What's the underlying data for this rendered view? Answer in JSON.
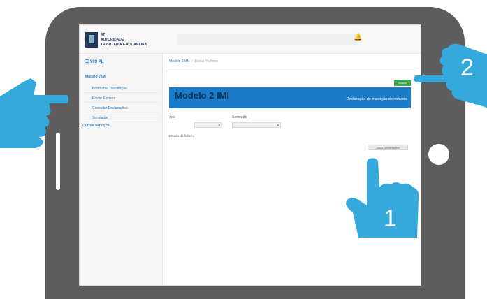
{
  "topbar": {
    "logo_lines": [
      "AT",
      "AUTORIDADE",
      "TRIBUTÁRIA E ADUANEIRA"
    ],
    "bell_icon": "bell-icon"
  },
  "sidebar": {
    "user": "☰ 999 PL",
    "group": "Modelo 2 IMI",
    "items": [
      {
        "label": "Preencher Declaração"
      },
      {
        "label": "Enviar Ficheiro"
      },
      {
        "label": "Consultar Declarações"
      },
      {
        "label": "Simulador"
      }
    ],
    "other": "Outros Serviços"
  },
  "main": {
    "breadcrumb": [
      "Modelo 2 IMI",
      "Enviar Ficheiro"
    ],
    "save_label": "Gravar",
    "banner_title": "Modelo 2 IMI",
    "banner_sub": "Declaração de inscrição de imóveis",
    "form": {
      "ano_label": "Ano",
      "ano_value": "▾",
      "semestre_label": "Semestre",
      "semestre_value": "▾",
      "status_text": "Estado do ficheiro",
      "list_button": "Listar Declarações"
    }
  },
  "markers": {
    "hand_1": "1",
    "hand_2": "2"
  },
  "colors": {
    "hand_blue": "#35a8dc",
    "banner_blue": "#1a7bc8",
    "save_green": "#3aa54a",
    "tablet_frame": "#5d5d5d"
  }
}
